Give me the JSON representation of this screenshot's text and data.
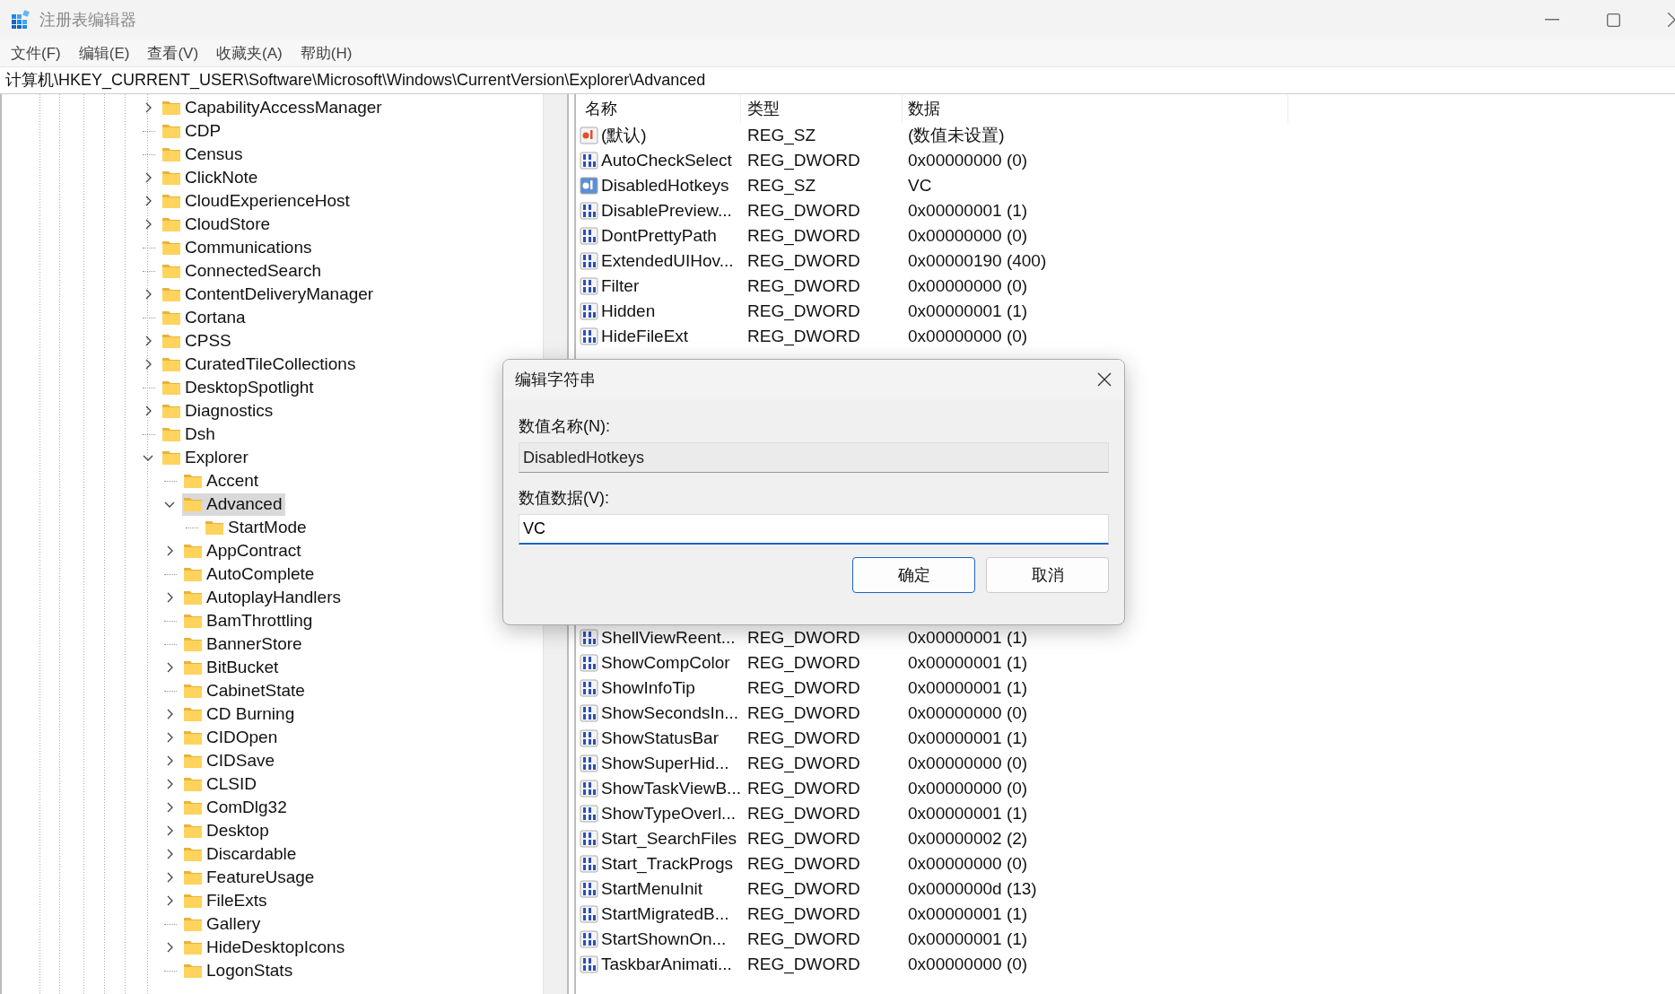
{
  "window": {
    "title": "注册表编辑器"
  },
  "menu": [
    "文件(F)",
    "编辑(E)",
    "查看(V)",
    "收藏夹(A)",
    "帮助(H)"
  ],
  "address": "计算机\\HKEY_CURRENT_USER\\Software\\Microsoft\\Windows\\CurrentVersion\\Explorer\\Advanced",
  "tree": [
    {
      "name": "CapabilityAccessManager",
      "expandable": true,
      "expanded": false,
      "selected": false
    },
    {
      "name": "CDP",
      "expandable": false,
      "selected": false
    },
    {
      "name": "Census",
      "expandable": false,
      "selected": false
    },
    {
      "name": "ClickNote",
      "expandable": true,
      "expanded": false,
      "selected": false
    },
    {
      "name": "CloudExperienceHost",
      "expandable": true,
      "expanded": false,
      "selected": false
    },
    {
      "name": "CloudStore",
      "expandable": true,
      "expanded": false,
      "selected": false
    },
    {
      "name": "Communications",
      "expandable": false,
      "selected": false
    },
    {
      "name": "ConnectedSearch",
      "expandable": false,
      "selected": false
    },
    {
      "name": "ContentDeliveryManager",
      "expandable": true,
      "expanded": false,
      "selected": false
    },
    {
      "name": "Cortana",
      "expandable": false,
      "selected": false
    },
    {
      "name": "CPSS",
      "expandable": true,
      "expanded": false,
      "selected": false
    },
    {
      "name": "CuratedTileCollections",
      "expandable": true,
      "expanded": false,
      "selected": false
    },
    {
      "name": "DesktopSpotlight",
      "expandable": false,
      "selected": false
    },
    {
      "name": "Diagnostics",
      "expandable": true,
      "expanded": false,
      "selected": false
    },
    {
      "name": "Dsh",
      "expandable": false,
      "selected": false
    },
    {
      "name": "Explorer",
      "expandable": true,
      "expanded": true,
      "selected": false,
      "children": [
        {
          "name": "Accent",
          "expandable": false,
          "selected": false
        },
        {
          "name": "Advanced",
          "expandable": true,
          "expanded": true,
          "selected": true,
          "children": [
            {
              "name": "StartMode",
              "expandable": false,
              "selected": false
            }
          ]
        },
        {
          "name": "AppContract",
          "expandable": true,
          "expanded": false,
          "selected": false
        },
        {
          "name": "AutoComplete",
          "expandable": false,
          "selected": false
        },
        {
          "name": "AutoplayHandlers",
          "expandable": true,
          "expanded": false,
          "selected": false
        },
        {
          "name": "BamThrottling",
          "expandable": false,
          "selected": false
        },
        {
          "name": "BannerStore",
          "expandable": false,
          "selected": false
        },
        {
          "name": "BitBucket",
          "expandable": true,
          "expanded": false,
          "selected": false
        },
        {
          "name": "CabinetState",
          "expandable": false,
          "selected": false
        },
        {
          "name": "CD Burning",
          "expandable": true,
          "expanded": false,
          "selected": false
        },
        {
          "name": "CIDOpen",
          "expandable": true,
          "expanded": false,
          "selected": false
        },
        {
          "name": "CIDSave",
          "expandable": true,
          "expanded": false,
          "selected": false
        },
        {
          "name": "CLSID",
          "expandable": true,
          "expanded": false,
          "selected": false
        },
        {
          "name": "ComDlg32",
          "expandable": true,
          "expanded": false,
          "selected": false
        },
        {
          "name": "Desktop",
          "expandable": true,
          "expanded": false,
          "selected": false
        },
        {
          "name": "Discardable",
          "expandable": true,
          "expanded": false,
          "selected": false
        },
        {
          "name": "FeatureUsage",
          "expandable": true,
          "expanded": false,
          "selected": false
        },
        {
          "name": "FileExts",
          "expandable": true,
          "expanded": false,
          "selected": false
        },
        {
          "name": "Gallery",
          "expandable": false,
          "selected": false
        },
        {
          "name": "HideDesktopIcons",
          "expandable": true,
          "expanded": false,
          "selected": false
        },
        {
          "name": "LogonStats",
          "expandable": false,
          "selected": false
        }
      ]
    }
  ],
  "table": {
    "columns": [
      "名称",
      "类型",
      "数据"
    ],
    "rows_top": [
      {
        "kind": "string",
        "selected": false,
        "name": "(默认)",
        "type": "REG_SZ",
        "data": "(数值未设置)"
      },
      {
        "kind": "number",
        "selected": false,
        "name": "AutoCheckSelect",
        "type": "REG_DWORD",
        "data": "0x00000000 (0)"
      },
      {
        "kind": "string",
        "selected": true,
        "name": "DisabledHotkeys",
        "type": "REG_SZ",
        "data": "VC"
      },
      {
        "kind": "number",
        "selected": false,
        "name": "DisablePreview...",
        "type": "REG_DWORD",
        "data": "0x00000001 (1)"
      },
      {
        "kind": "number",
        "selected": false,
        "name": "DontPrettyPath",
        "type": "REG_DWORD",
        "data": "0x00000000 (0)"
      },
      {
        "kind": "number",
        "selected": false,
        "name": "ExtendedUIHov...",
        "type": "REG_DWORD",
        "data": "0x00000190 (400)"
      },
      {
        "kind": "number",
        "selected": false,
        "name": "Filter",
        "type": "REG_DWORD",
        "data": "0x00000000 (0)"
      },
      {
        "kind": "number",
        "selected": false,
        "name": "Hidden",
        "type": "REG_DWORD",
        "data": "0x00000001 (1)"
      },
      {
        "kind": "number",
        "selected": false,
        "name": "HideFileExt",
        "type": "REG_DWORD",
        "data": "0x00000000 (0)"
      }
    ],
    "rows_bottom": [
      {
        "kind": "number",
        "selected": false,
        "name": "ShellViewReent...",
        "type": "REG_DWORD",
        "data": "0x00000001 (1)"
      },
      {
        "kind": "number",
        "selected": false,
        "name": "ShowCompColor",
        "type": "REG_DWORD",
        "data": "0x00000001 (1)"
      },
      {
        "kind": "number",
        "selected": false,
        "name": "ShowInfoTip",
        "type": "REG_DWORD",
        "data": "0x00000001 (1)"
      },
      {
        "kind": "number",
        "selected": false,
        "name": "ShowSecondsIn...",
        "type": "REG_DWORD",
        "data": "0x00000000 (0)"
      },
      {
        "kind": "number",
        "selected": false,
        "name": "ShowStatusBar",
        "type": "REG_DWORD",
        "data": "0x00000001 (1)"
      },
      {
        "kind": "number",
        "selected": false,
        "name": "ShowSuperHid...",
        "type": "REG_DWORD",
        "data": "0x00000000 (0)"
      },
      {
        "kind": "number",
        "selected": false,
        "name": "ShowTaskViewB...",
        "type": "REG_DWORD",
        "data": "0x00000000 (0)"
      },
      {
        "kind": "number",
        "selected": false,
        "name": "ShowTypeOverl...",
        "type": "REG_DWORD",
        "data": "0x00000001 (1)"
      },
      {
        "kind": "number",
        "selected": false,
        "name": "Start_SearchFiles",
        "type": "REG_DWORD",
        "data": "0x00000002 (2)"
      },
      {
        "kind": "number",
        "selected": false,
        "name": "Start_TrackProgs",
        "type": "REG_DWORD",
        "data": "0x00000000 (0)"
      },
      {
        "kind": "number",
        "selected": false,
        "name": "StartMenuInit",
        "type": "REG_DWORD",
        "data": "0x0000000d (13)"
      },
      {
        "kind": "number",
        "selected": false,
        "name": "StartMigratedB...",
        "type": "REG_DWORD",
        "data": "0x00000001 (1)"
      },
      {
        "kind": "number",
        "selected": false,
        "name": "StartShownOn...",
        "type": "REG_DWORD",
        "data": "0x00000001 (1)"
      },
      {
        "kind": "number",
        "selected": false,
        "name": "TaskbarAnimati...",
        "type": "REG_DWORD",
        "data": "0x00000000 (0)"
      }
    ]
  },
  "dialog": {
    "title": "编辑字符串",
    "name_label": "数值名称(N):",
    "name_value": "DisabledHotkeys",
    "data_label": "数值数据(V):",
    "data_value": "VC",
    "buttons": [
      {
        "label": "确定",
        "default": true
      },
      {
        "label": "取消",
        "default": false
      }
    ]
  }
}
